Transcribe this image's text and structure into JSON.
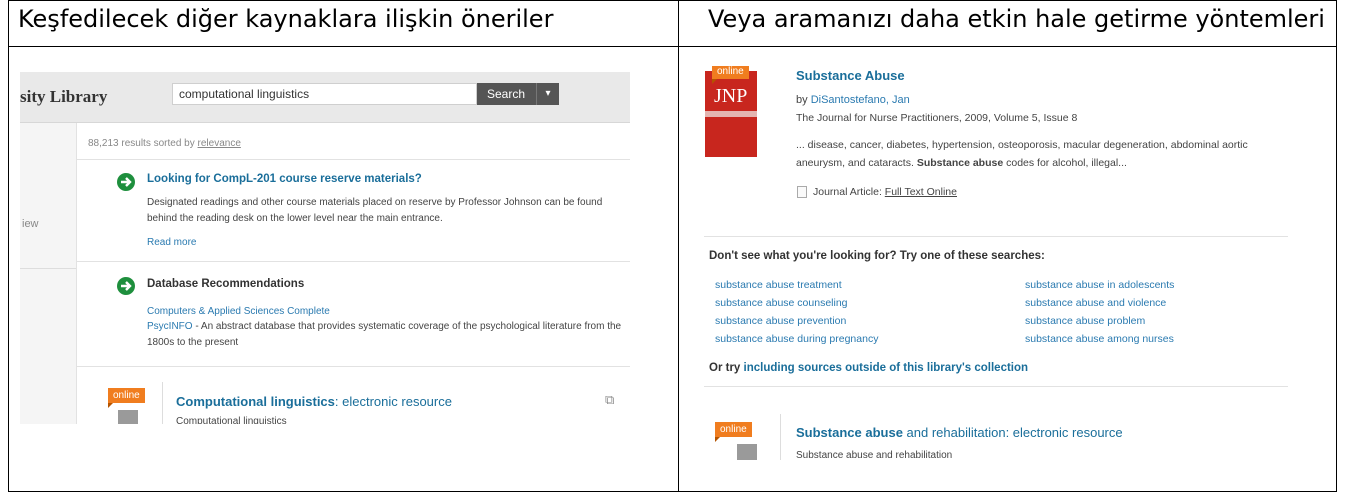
{
  "headers": {
    "left": "Keşfedilecek diğer kaynaklara ilişkin öneriler",
    "right": "Veya aramanızı daha etkin hale getirme yöntemleri"
  },
  "left_panel": {
    "library_name": "sity Library",
    "search_value": "computational linguistics",
    "search_button": "Search",
    "sidebar_label": "iew",
    "results_count": "88,213 results sorted by ",
    "sort_by": "relevance",
    "reserve": {
      "title": "Looking for CompL-201 course reserve materials?",
      "text": "Designated readings and other course materials placed on reserve by Professor Johnson can be found behind the reading desk on the lower level near the main entrance.",
      "read_more": "Read more"
    },
    "db_rec": {
      "title": "Database Recommendations",
      "link1": "Computers & Applied Sciences Complete",
      "link2": "PsycINFO",
      "link2_desc": " - An abstract database that provides systematic coverage of the psychological literature from the 1800s to the present"
    },
    "result": {
      "badge": "online",
      "title_bold": "Computational linguistics",
      "title_rest": ": electronic resource",
      "subtitle": "Computational linguistics"
    }
  },
  "right_panel": {
    "cover_text": "JNP",
    "badge": "online",
    "title": "Substance Abuse",
    "by_label": "by ",
    "author": "DiSantostefano, Jan",
    "source": "The Journal for Nurse Practitioners, 2009, Volume 5, Issue 8",
    "snippet_a": "... disease, cancer, diabetes, hypertension, osteoporosis, macular degeneration, abdominal aortic aneurysm, and cataracts. ",
    "snippet_bold": "Substance abuse",
    "snippet_b": " codes for alcohol, illegal...",
    "type_label": "Journal Article: ",
    "type_link": "Full Text Online",
    "dont_see": "Don't see what you're looking for? Try one of these searches:",
    "suggestions_left": [
      "substance abuse treatment",
      "substance abuse counseling",
      "substance abuse prevention",
      "substance abuse during pregnancy"
    ],
    "suggestions_right": [
      "substance abuse in adolescents",
      "substance abuse and violence",
      "substance abuse problem",
      "substance abuse among nurses"
    ],
    "or_try": "Or try ",
    "or_try_link": "including sources outside of this library's collection",
    "result": {
      "badge": "online",
      "title_bold": "Substance abuse",
      "title_rest": " and rehabilitation: electronic resource",
      "subtitle": "Substance abuse and rehabilitation"
    }
  }
}
